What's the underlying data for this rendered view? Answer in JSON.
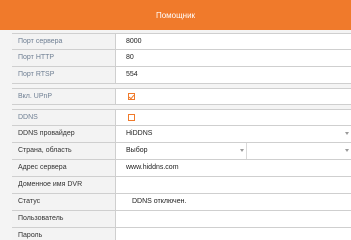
{
  "window": {
    "title": "Помощник"
  },
  "fields": {
    "server_port": {
      "label": "Порт сервера",
      "value": "8000"
    },
    "http_port": {
      "label": "Порт HTTP",
      "value": "80"
    },
    "rtsp_port": {
      "label": "Порт RTSP",
      "value": "554"
    },
    "upnp": {
      "label": "Вкл. UPnP",
      "checked": true
    },
    "ddns": {
      "label": "DDNS",
      "checked": false
    },
    "ddns_provider": {
      "label": "DDNS провайдер",
      "value": "HiDDNS"
    },
    "country_region": {
      "label": "Страна, область",
      "value": "Выбор",
      "second_value": ""
    },
    "server_address": {
      "label": "Адрес сервера",
      "value": "www.hiddns.com"
    },
    "domain_name": {
      "label": "Доменное имя DVR",
      "value": ""
    },
    "status": {
      "label": "Статус",
      "value": "DDNS отключен."
    },
    "user": {
      "label": "Пользователь",
      "value": ""
    },
    "password": {
      "label": "Пароль",
      "value": ""
    }
  },
  "colors": {
    "accent": "#f07a2b",
    "muted_label": "#6f7f93"
  }
}
